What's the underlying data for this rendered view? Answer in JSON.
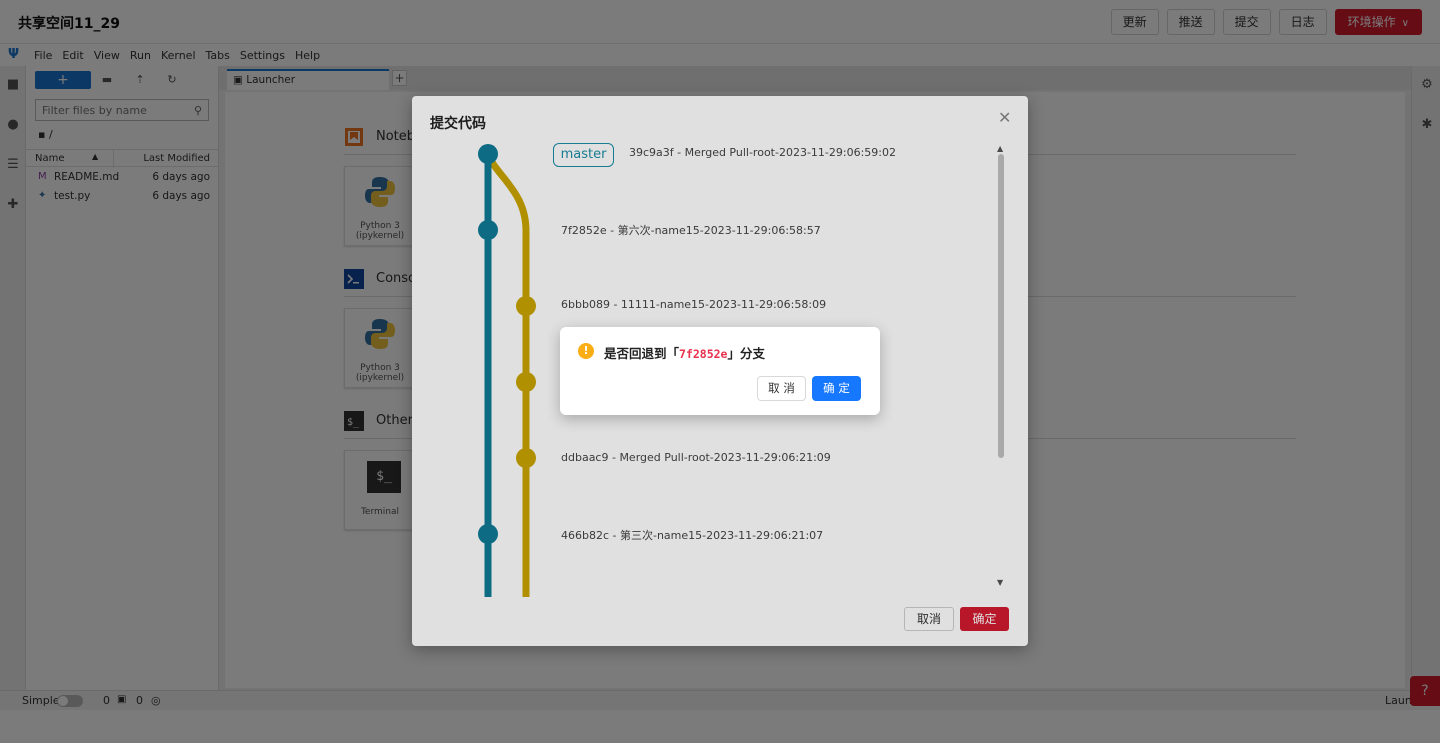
{
  "app": {
    "title": "共享空间11_29"
  },
  "topbar": {
    "buttons": [
      "更新",
      "推送",
      "提交",
      "日志"
    ],
    "env_button": "环境操作"
  },
  "menubar": {
    "items": [
      "File",
      "Edit",
      "View",
      "Run",
      "Kernel",
      "Tabs",
      "Settings",
      "Help"
    ]
  },
  "filebrowser": {
    "new_label": "+",
    "filter_placeholder": "Filter files by name",
    "breadcrumb": "/",
    "columns": {
      "name": "Name",
      "modified": "Last Modified"
    },
    "files": [
      {
        "name": "README.md",
        "modified": "6 days ago"
      },
      {
        "name": "test.py",
        "modified": "6 days ago"
      }
    ]
  },
  "tabs": [
    {
      "label": "Launcher"
    }
  ],
  "tab_add": "+",
  "launcher": {
    "sections": [
      "Notebo",
      "Consol",
      "Other"
    ],
    "cards": [
      {
        "label": "Python 3 (ipykernel)"
      },
      {
        "label": "Python 3 (ipykernel)"
      },
      {
        "label": "Terminal"
      }
    ],
    "terminal_glyph": "$_",
    "console_glyph": ">_"
  },
  "statusbar": {
    "simple": "Simple",
    "count1": "0",
    "count2": "0",
    "right_text": "Launc"
  },
  "dialog": {
    "title": "提交代码",
    "branch_tag": "master",
    "commits": [
      "39c9a3f - Merged Pull-root-2023-11-29:06:59:02",
      "7f2852e - 第六次-name15-2023-11-29:06:58:57",
      "6bbb089 - 11111-name15-2023-11-29:06:58:09",
      "ddbaac9 - Merged Pull-root-2023-11-29:06:21:09",
      "466b82c - 第三次-name15-2023-11-29:06:21:07"
    ],
    "cancel": "取消",
    "ok": "确定",
    "colors": {
      "main_branch": "#0f7c96",
      "side_branch": "#c9a400",
      "accent": "#d21a2f"
    }
  },
  "confirm": {
    "prefix": "是否回退到「",
    "hash": "7f2852e",
    "suffix": "」分支",
    "cancel": "取 消",
    "ok": "确 定",
    "icon": "exclamation-icon"
  }
}
